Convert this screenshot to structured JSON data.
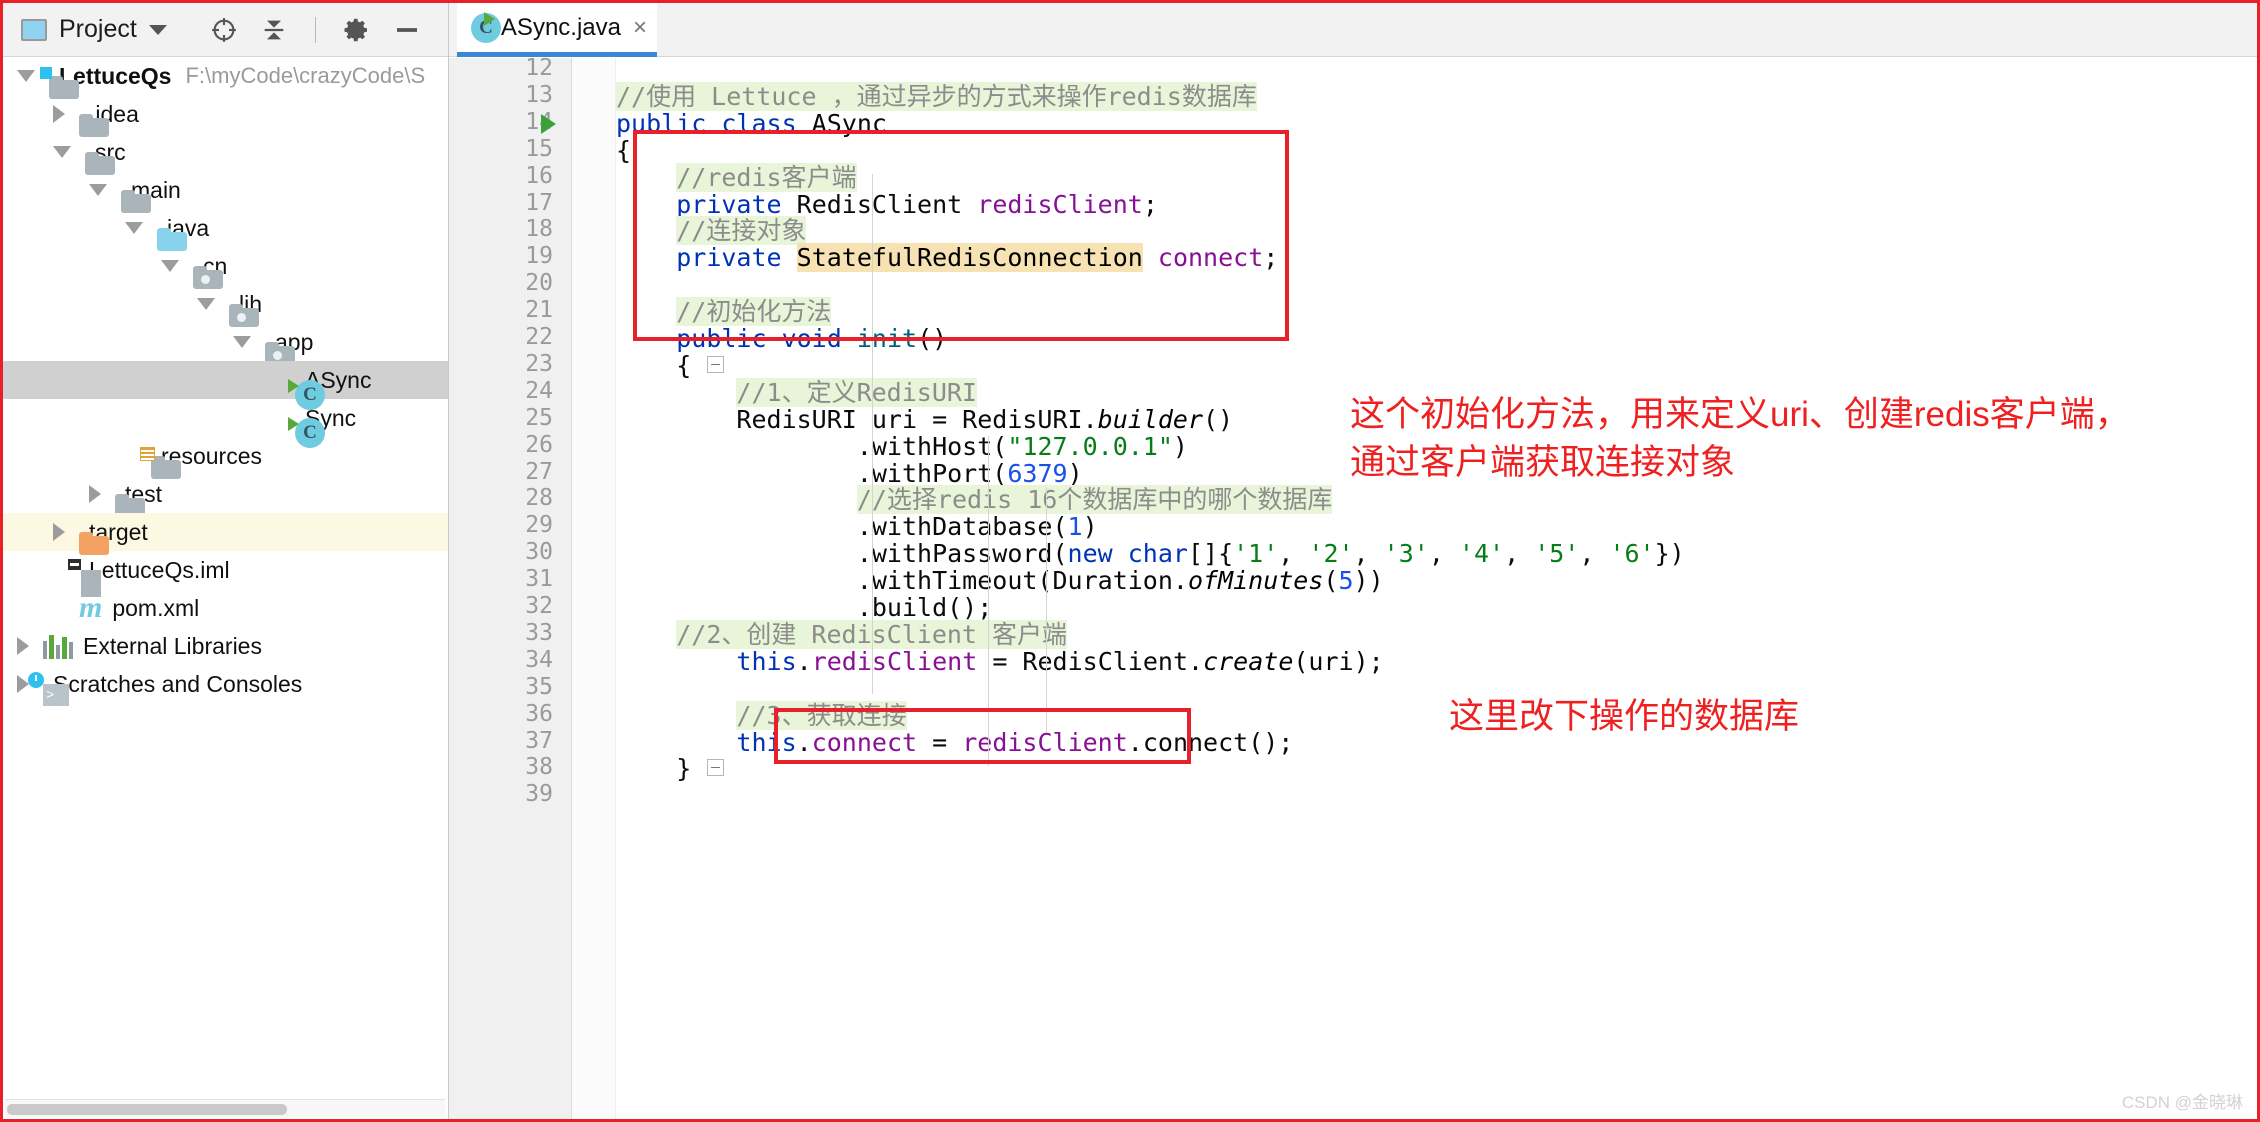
{
  "window": {
    "accent_red": "#e8202a",
    "accent_blue": "#3a87d6",
    "watermark": "CSDN @金晓琳"
  },
  "project_panel": {
    "title": "Project",
    "toolbar_icons": [
      "locate-icon",
      "collapse-all-icon",
      "settings-gear-icon",
      "minimize-icon"
    ],
    "tree": [
      {
        "label": "LettuceQs",
        "path": "F:\\myCode\\crazyCode\\S",
        "icon": "module-folder-icon",
        "state": "open",
        "depth": 0,
        "bold": true
      },
      {
        "label": ".idea",
        "path": "",
        "icon": "folder-icon",
        "state": "closed",
        "depth": 1,
        "bold": false
      },
      {
        "label": "src",
        "path": "",
        "icon": "folder-icon",
        "state": "open",
        "depth": 1,
        "bold": false
      },
      {
        "label": "main",
        "path": "",
        "icon": "folder-icon",
        "state": "open",
        "depth": 2,
        "bold": false
      },
      {
        "label": "java",
        "path": "",
        "icon": "source-folder-icon",
        "state": "open",
        "depth": 3,
        "bold": false
      },
      {
        "label": "cn",
        "path": "",
        "icon": "package-folder-icon",
        "state": "open",
        "depth": 4,
        "bold": false
      },
      {
        "label": "ljh",
        "path": "",
        "icon": "package-folder-icon",
        "state": "open",
        "depth": 5,
        "bold": false
      },
      {
        "label": "app",
        "path": "",
        "icon": "package-folder-icon",
        "state": "open",
        "depth": 6,
        "bold": false
      },
      {
        "label": "ASync",
        "path": "",
        "icon": "java-class-icon",
        "state": "leaf",
        "depth": 7,
        "bold": false,
        "selected": true
      },
      {
        "label": "Sync",
        "path": "",
        "icon": "java-class-icon",
        "state": "leaf",
        "depth": 7,
        "bold": false
      },
      {
        "label": "resources",
        "path": "",
        "icon": "resources-folder-icon",
        "state": "leaf",
        "depth": 3,
        "bold": false
      },
      {
        "label": "test",
        "path": "",
        "icon": "folder-icon",
        "state": "closed",
        "depth": 2,
        "bold": false
      },
      {
        "label": "target",
        "path": "",
        "icon": "excluded-folder-icon",
        "state": "closed",
        "depth": 1,
        "bold": false,
        "highlight": true
      },
      {
        "label": "LettuceQs.iml",
        "path": "",
        "icon": "iml-file-icon",
        "state": "leaf",
        "depth": 1,
        "bold": false
      },
      {
        "label": "pom.xml",
        "path": "",
        "icon": "maven-file-icon",
        "state": "leaf",
        "depth": 1,
        "bold": false
      },
      {
        "label": "External Libraries",
        "path": "",
        "icon": "libraries-icon",
        "state": "closed",
        "depth": 0,
        "bold": false
      },
      {
        "label": "Scratches and Consoles",
        "path": "",
        "icon": "scratches-icon",
        "state": "closed",
        "depth": 0,
        "bold": false
      }
    ]
  },
  "editor": {
    "tabs": [
      {
        "label": "ASync.java",
        "icon": "java-class-icon",
        "close": "×",
        "active": true
      }
    ],
    "line_numbers": [
      "12",
      "13",
      "14",
      "15",
      "16",
      "17",
      "18",
      "19",
      "20",
      "21",
      "22",
      "23",
      "24",
      "25",
      "26",
      "27",
      "28",
      "29",
      "30",
      "31",
      "32",
      "33",
      "34",
      "35",
      "36",
      "37",
      "38",
      "39"
    ],
    "run_marker_line": "14",
    "code_lines": [
      {
        "n": "12",
        "segments": []
      },
      {
        "n": "13",
        "segments": [
          {
            "t": "//使用 Lettuce ，通过异步的方式来操作redis数据库",
            "c": "cmt"
          }
        ]
      },
      {
        "n": "14",
        "segments": [
          {
            "t": "public ",
            "c": "kw"
          },
          {
            "t": "class ",
            "c": "kw"
          },
          {
            "t": "ASync",
            "c": "cls"
          }
        ]
      },
      {
        "n": "15",
        "segments": [
          {
            "t": "{",
            "c": "stat"
          }
        ]
      },
      {
        "n": "16",
        "segments": [
          {
            "t": "    ",
            "c": "stat"
          },
          {
            "t": "//redis客户端",
            "c": "cmt"
          }
        ]
      },
      {
        "n": "17",
        "segments": [
          {
            "t": "    ",
            "c": "stat"
          },
          {
            "t": "private ",
            "c": "kw"
          },
          {
            "t": "RedisClient ",
            "c": "cls"
          },
          {
            "t": "redisClient",
            "c": "fld"
          },
          {
            "t": ";",
            "c": "stat"
          }
        ]
      },
      {
        "n": "18",
        "segments": [
          {
            "t": "    ",
            "c": "stat"
          },
          {
            "t": "//连接对象",
            "c": "cmt"
          }
        ]
      },
      {
        "n": "19",
        "segments": [
          {
            "t": "    ",
            "c": "stat"
          },
          {
            "t": "private ",
            "c": "kw"
          },
          {
            "t": "StatefulRedisConnection",
            "c": "hl-ident"
          },
          {
            "t": " ",
            "c": "stat"
          },
          {
            "t": "connect",
            "c": "fld"
          },
          {
            "t": ";",
            "c": "stat"
          }
        ]
      },
      {
        "n": "20",
        "segments": []
      },
      {
        "n": "21",
        "segments": [
          {
            "t": "    ",
            "c": "stat"
          },
          {
            "t": "//初始化方法",
            "c": "cmt"
          }
        ]
      },
      {
        "n": "22",
        "segments": [
          {
            "t": "    ",
            "c": "stat"
          },
          {
            "t": "public ",
            "c": "kw"
          },
          {
            "t": "void ",
            "c": "kw"
          },
          {
            "t": "init",
            "c": "mth"
          },
          {
            "t": "()",
            "c": "stat"
          }
        ]
      },
      {
        "n": "23",
        "segments": [
          {
            "t": "    {",
            "c": "stat"
          }
        ]
      },
      {
        "n": "24",
        "segments": [
          {
            "t": "        ",
            "c": "stat"
          },
          {
            "t": "//1、定义RedisURI",
            "c": "cmt"
          }
        ]
      },
      {
        "n": "25",
        "segments": [
          {
            "t": "        RedisURI uri = RedisURI.",
            "c": "stat"
          },
          {
            "t": "builder",
            "c": "ital"
          },
          {
            "t": "()",
            "c": "stat"
          }
        ]
      },
      {
        "n": "26",
        "segments": [
          {
            "t": "                .withHost(",
            "c": "stat"
          },
          {
            "t": "\"127.0.0.1\"",
            "c": "str"
          },
          {
            "t": ")",
            "c": "stat"
          }
        ]
      },
      {
        "n": "27",
        "segments": [
          {
            "t": "                .withPort(",
            "c": "stat"
          },
          {
            "t": "6379",
            "c": "num"
          },
          {
            "t": ")",
            "c": "stat"
          }
        ]
      },
      {
        "n": "28",
        "segments": [
          {
            "t": "                ",
            "c": "stat"
          },
          {
            "t": "//选择redis 16个数据库中的哪个数据库",
            "c": "cmt"
          }
        ]
      },
      {
        "n": "29",
        "segments": [
          {
            "t": "                .withDatabase(",
            "c": "stat"
          },
          {
            "t": "1",
            "c": "num"
          },
          {
            "t": ")",
            "c": "stat"
          }
        ]
      },
      {
        "n": "30",
        "segments": [
          {
            "t": "                .withPassword(",
            "c": "stat"
          },
          {
            "t": "new char",
            "c": "kw"
          },
          {
            "t": "[]{",
            "c": "stat"
          },
          {
            "t": "'1'",
            "c": "str"
          },
          {
            "t": ", ",
            "c": "stat"
          },
          {
            "t": "'2'",
            "c": "str"
          },
          {
            "t": ", ",
            "c": "stat"
          },
          {
            "t": "'3'",
            "c": "str"
          },
          {
            "t": ", ",
            "c": "stat"
          },
          {
            "t": "'4'",
            "c": "str"
          },
          {
            "t": ", ",
            "c": "stat"
          },
          {
            "t": "'5'",
            "c": "str"
          },
          {
            "t": ", ",
            "c": "stat"
          },
          {
            "t": "'6'",
            "c": "str"
          },
          {
            "t": "})",
            "c": "stat"
          }
        ]
      },
      {
        "n": "31",
        "segments": [
          {
            "t": "                .withTimeout(Duration.",
            "c": "stat"
          },
          {
            "t": "ofMinutes",
            "c": "ital"
          },
          {
            "t": "(",
            "c": "stat"
          },
          {
            "t": "5",
            "c": "num"
          },
          {
            "t": "))",
            "c": "stat"
          }
        ]
      },
      {
        "n": "32",
        "segments": [
          {
            "t": "                .build();",
            "c": "stat"
          }
        ]
      },
      {
        "n": "33",
        "segments": [
          {
            "t": "    ",
            "c": "stat"
          },
          {
            "t": "//2、创建 RedisClient 客户端",
            "c": "cmt"
          }
        ]
      },
      {
        "n": "34",
        "segments": [
          {
            "t": "        ",
            "c": "stat"
          },
          {
            "t": "this",
            "c": "kw"
          },
          {
            "t": ".",
            "c": "stat"
          },
          {
            "t": "redisClient",
            "c": "fld"
          },
          {
            "t": " = RedisClient.",
            "c": "stat"
          },
          {
            "t": "create",
            "c": "ital"
          },
          {
            "t": "(uri);",
            "c": "stat"
          }
        ]
      },
      {
        "n": "35",
        "segments": []
      },
      {
        "n": "36",
        "segments": [
          {
            "t": "        ",
            "c": "stat"
          },
          {
            "t": "//3、获取连接",
            "c": "cmt"
          }
        ]
      },
      {
        "n": "37",
        "segments": [
          {
            "t": "        ",
            "c": "stat"
          },
          {
            "t": "this",
            "c": "kw"
          },
          {
            "t": ".",
            "c": "stat"
          },
          {
            "t": "connect",
            "c": "fld"
          },
          {
            "t": " = ",
            "c": "stat"
          },
          {
            "t": "redisClient",
            "c": "fld"
          },
          {
            "t": ".connect();",
            "c": "stat"
          }
        ]
      },
      {
        "n": "38",
        "segments": [
          {
            "t": "    }",
            "c": "stat"
          }
        ]
      },
      {
        "n": "39",
        "segments": []
      }
    ]
  },
  "annotations": {
    "box_fields": {
      "name": "fields-declaration-box"
    },
    "box_database": {
      "name": "with-database-box"
    },
    "note_init": "这个初始化方法，用来定义uri、创建redis客户端，\n通过客户端获取连接对象",
    "note_database": "这里改下操作的数据库"
  }
}
